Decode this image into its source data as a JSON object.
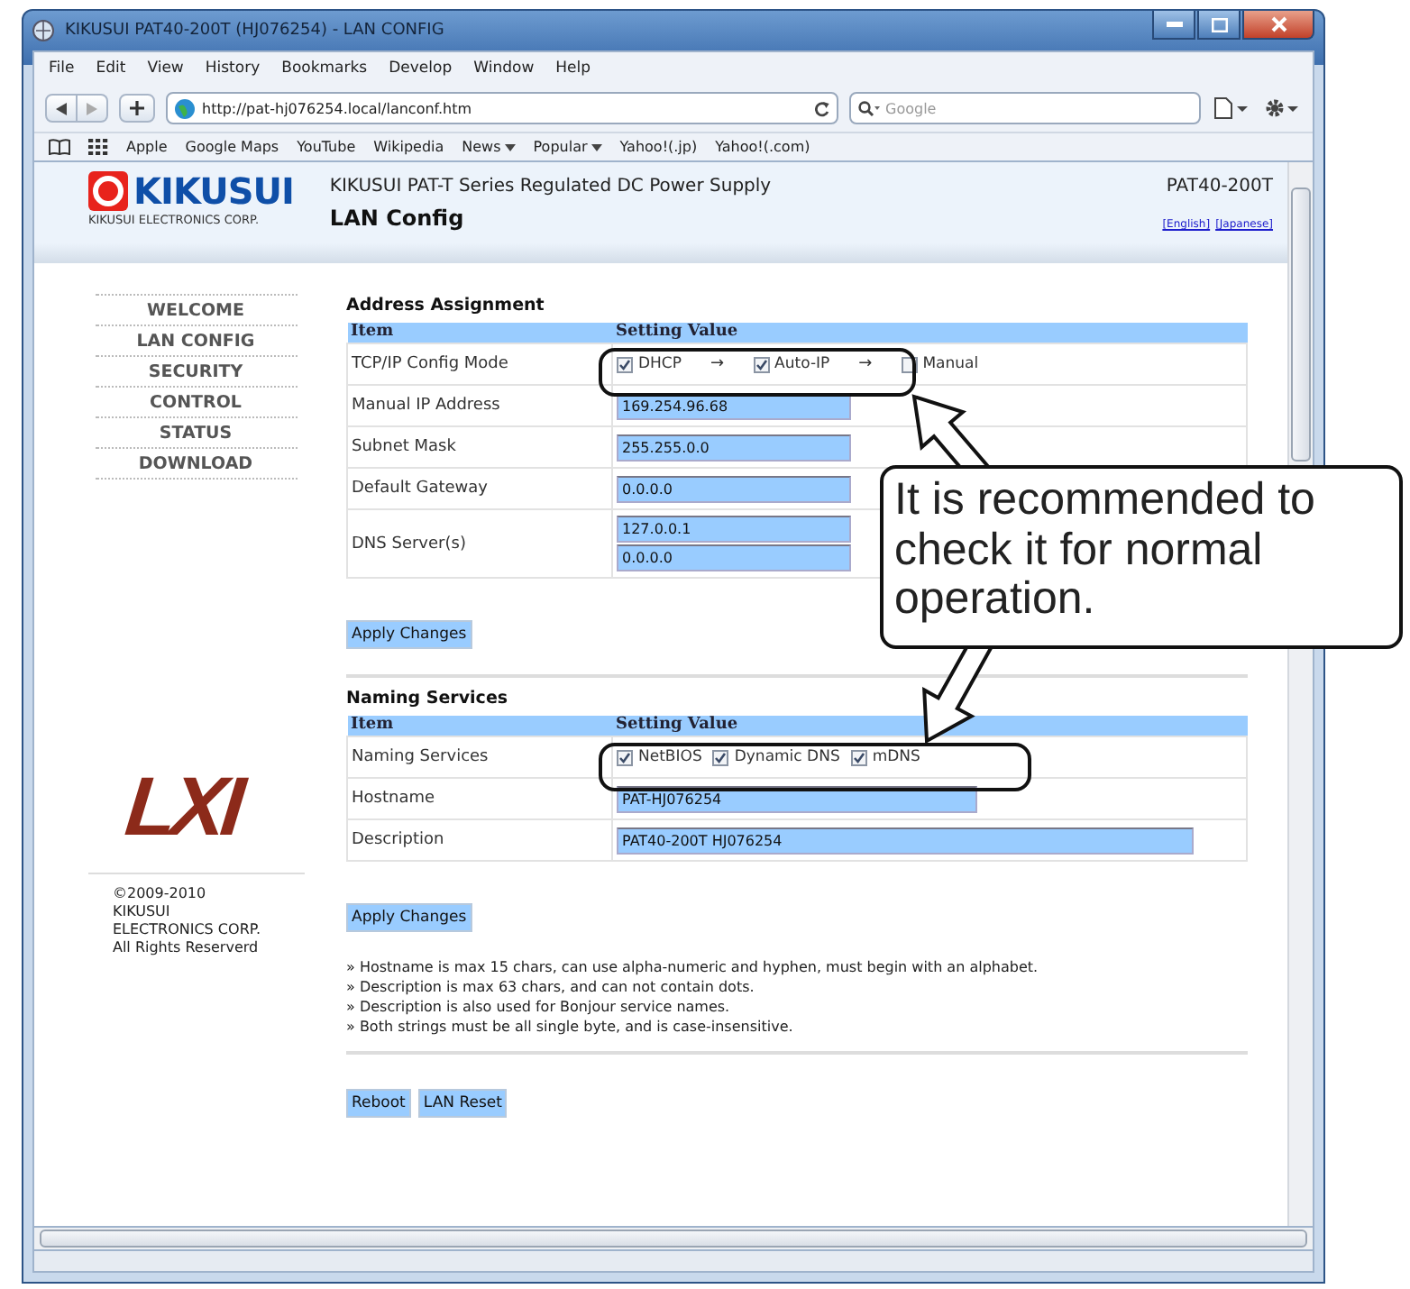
{
  "window": {
    "title": "KIKUSUI PAT40-200T (HJ076254) - LAN CONFIG"
  },
  "menu": [
    "File",
    "Edit",
    "View",
    "History",
    "Bookmarks",
    "Develop",
    "Window",
    "Help"
  ],
  "address_bar": {
    "url": "http://pat-hj076254.local/lanconf.htm"
  },
  "search": {
    "placeholder": "Google"
  },
  "bookmarks": [
    {
      "label": "Apple",
      "dropdown": false
    },
    {
      "label": "Google Maps",
      "dropdown": false
    },
    {
      "label": "YouTube",
      "dropdown": false
    },
    {
      "label": "Wikipedia",
      "dropdown": false
    },
    {
      "label": "News",
      "dropdown": true
    },
    {
      "label": "Popular",
      "dropdown": true
    },
    {
      "label": "Yahoo!(.jp)",
      "dropdown": false
    },
    {
      "label": "Yahoo!(.com)",
      "dropdown": false
    }
  ],
  "header": {
    "logo_name": "KIKUSUI",
    "logo_sub": "KIKUSUI ELECTRONICS CORP.",
    "subtitle": "KIKUSUI PAT-T Series Regulated DC Power Supply",
    "title": "LAN Config",
    "model": "PAT40-200T",
    "languages": [
      "[English]",
      "[Japanese]"
    ]
  },
  "nav": [
    "WELCOME",
    "LAN CONFIG",
    "SECURITY",
    "CONTROL",
    "STATUS",
    "DOWNLOAD"
  ],
  "lxi_logo": "LXI",
  "copyright": "©2009-2010\nKIKUSUI\nELECTRONICS CORP.\nAll Rights Reserverd",
  "sections": [
    {
      "heading": "Address Assignment",
      "columns": [
        "Item",
        "Setting Value"
      ],
      "apply": "Apply Changes",
      "rows": [
        {
          "kind": "options",
          "label": "TCP/IP Config Mode",
          "items": [
            {
              "kind": "check",
              "label": "DHCP",
              "checked": true
            },
            {
              "kind": "arrow",
              "text": "→"
            },
            {
              "kind": "check",
              "label": "Auto-IP",
              "checked": true
            },
            {
              "kind": "arrow",
              "text": "→"
            },
            {
              "kind": "check",
              "label": "Manual",
              "checked": false
            }
          ]
        },
        {
          "kind": "fields",
          "label": "Manual IP Address",
          "values": [
            "169.254.96.68"
          ]
        },
        {
          "kind": "fields",
          "label": "Subnet Mask",
          "values": [
            "255.255.0.0"
          ]
        },
        {
          "kind": "fields",
          "label": "Default Gateway",
          "values": [
            "0.0.0.0"
          ]
        },
        {
          "kind": "fields",
          "label": "DNS Server(s)",
          "values": [
            "127.0.0.1",
            "0.0.0.0"
          ]
        }
      ]
    },
    {
      "heading": "Naming Services",
      "columns": [
        "Item",
        "Setting Value"
      ],
      "apply": "Apply Changes",
      "rows": [
        {
          "kind": "options",
          "label": "Naming Services",
          "items": [
            {
              "kind": "check",
              "label": "NetBIOS",
              "checked": true
            },
            {
              "kind": "check",
              "label": "Dynamic DNS",
              "checked": true
            },
            {
              "kind": "check",
              "label": "mDNS",
              "checked": true
            }
          ]
        },
        {
          "kind": "fields",
          "label": "Hostname",
          "values": [
            "PAT-HJ076254"
          ]
        },
        {
          "kind": "fields",
          "label": "Description",
          "values": [
            "PAT40-200T HJ076254"
          ]
        }
      ]
    }
  ],
  "notes": [
    "» Hostname is max 15 chars, can use alpha-numeric and hyphen, must begin with an alphabet.",
    "» Description is max 63 chars, and can not contain dots.",
    "» Description is also used for Bonjour service names.",
    "» Both strings must be all single byte, and is case-insensitive."
  ],
  "buttons": [
    "Reboot",
    "LAN Reset"
  ],
  "callout": {
    "text": "It is recommended to check it for normal operation."
  }
}
